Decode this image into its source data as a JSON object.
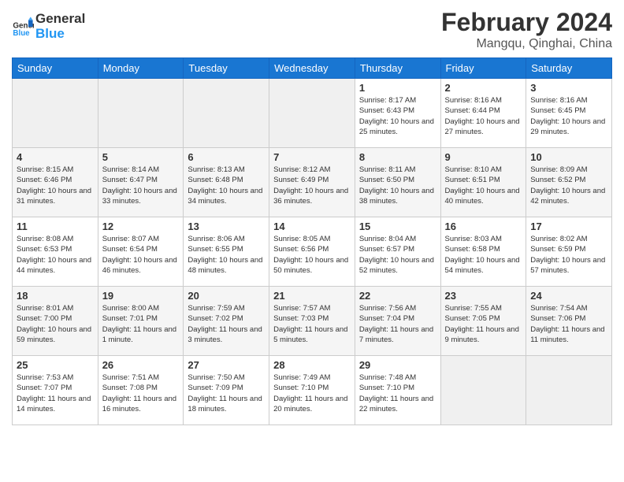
{
  "header": {
    "logo_line1": "General",
    "logo_line2": "Blue",
    "month_year": "February 2024",
    "location": "Mangqu, Qinghai, China"
  },
  "weekdays": [
    "Sunday",
    "Monday",
    "Tuesday",
    "Wednesday",
    "Thursday",
    "Friday",
    "Saturday"
  ],
  "weeks": [
    [
      {
        "day": "",
        "empty": true
      },
      {
        "day": "",
        "empty": true
      },
      {
        "day": "",
        "empty": true
      },
      {
        "day": "",
        "empty": true
      },
      {
        "day": "1",
        "sunrise": "8:17 AM",
        "sunset": "6:43 PM",
        "daylight": "10 hours and 25 minutes."
      },
      {
        "day": "2",
        "sunrise": "8:16 AM",
        "sunset": "6:44 PM",
        "daylight": "10 hours and 27 minutes."
      },
      {
        "day": "3",
        "sunrise": "8:16 AM",
        "sunset": "6:45 PM",
        "daylight": "10 hours and 29 minutes."
      }
    ],
    [
      {
        "day": "4",
        "sunrise": "8:15 AM",
        "sunset": "6:46 PM",
        "daylight": "10 hours and 31 minutes."
      },
      {
        "day": "5",
        "sunrise": "8:14 AM",
        "sunset": "6:47 PM",
        "daylight": "10 hours and 33 minutes."
      },
      {
        "day": "6",
        "sunrise": "8:13 AM",
        "sunset": "6:48 PM",
        "daylight": "10 hours and 34 minutes."
      },
      {
        "day": "7",
        "sunrise": "8:12 AM",
        "sunset": "6:49 PM",
        "daylight": "10 hours and 36 minutes."
      },
      {
        "day": "8",
        "sunrise": "8:11 AM",
        "sunset": "6:50 PM",
        "daylight": "10 hours and 38 minutes."
      },
      {
        "day": "9",
        "sunrise": "8:10 AM",
        "sunset": "6:51 PM",
        "daylight": "10 hours and 40 minutes."
      },
      {
        "day": "10",
        "sunrise": "8:09 AM",
        "sunset": "6:52 PM",
        "daylight": "10 hours and 42 minutes."
      }
    ],
    [
      {
        "day": "11",
        "sunrise": "8:08 AM",
        "sunset": "6:53 PM",
        "daylight": "10 hours and 44 minutes."
      },
      {
        "day": "12",
        "sunrise": "8:07 AM",
        "sunset": "6:54 PM",
        "daylight": "10 hours and 46 minutes."
      },
      {
        "day": "13",
        "sunrise": "8:06 AM",
        "sunset": "6:55 PM",
        "daylight": "10 hours and 48 minutes."
      },
      {
        "day": "14",
        "sunrise": "8:05 AM",
        "sunset": "6:56 PM",
        "daylight": "10 hours and 50 minutes."
      },
      {
        "day": "15",
        "sunrise": "8:04 AM",
        "sunset": "6:57 PM",
        "daylight": "10 hours and 52 minutes."
      },
      {
        "day": "16",
        "sunrise": "8:03 AM",
        "sunset": "6:58 PM",
        "daylight": "10 hours and 54 minutes."
      },
      {
        "day": "17",
        "sunrise": "8:02 AM",
        "sunset": "6:59 PM",
        "daylight": "10 hours and 57 minutes."
      }
    ],
    [
      {
        "day": "18",
        "sunrise": "8:01 AM",
        "sunset": "7:00 PM",
        "daylight": "10 hours and 59 minutes."
      },
      {
        "day": "19",
        "sunrise": "8:00 AM",
        "sunset": "7:01 PM",
        "daylight": "11 hours and 1 minute."
      },
      {
        "day": "20",
        "sunrise": "7:59 AM",
        "sunset": "7:02 PM",
        "daylight": "11 hours and 3 minutes."
      },
      {
        "day": "21",
        "sunrise": "7:57 AM",
        "sunset": "7:03 PM",
        "daylight": "11 hours and 5 minutes."
      },
      {
        "day": "22",
        "sunrise": "7:56 AM",
        "sunset": "7:04 PM",
        "daylight": "11 hours and 7 minutes."
      },
      {
        "day": "23",
        "sunrise": "7:55 AM",
        "sunset": "7:05 PM",
        "daylight": "11 hours and 9 minutes."
      },
      {
        "day": "24",
        "sunrise": "7:54 AM",
        "sunset": "7:06 PM",
        "daylight": "11 hours and 11 minutes."
      }
    ],
    [
      {
        "day": "25",
        "sunrise": "7:53 AM",
        "sunset": "7:07 PM",
        "daylight": "11 hours and 14 minutes."
      },
      {
        "day": "26",
        "sunrise": "7:51 AM",
        "sunset": "7:08 PM",
        "daylight": "11 hours and 16 minutes."
      },
      {
        "day": "27",
        "sunrise": "7:50 AM",
        "sunset": "7:09 PM",
        "daylight": "11 hours and 18 minutes."
      },
      {
        "day": "28",
        "sunrise": "7:49 AM",
        "sunset": "7:10 PM",
        "daylight": "11 hours and 20 minutes."
      },
      {
        "day": "29",
        "sunrise": "7:48 AM",
        "sunset": "7:10 PM",
        "daylight": "11 hours and 22 minutes."
      },
      {
        "day": "",
        "empty": true
      },
      {
        "day": "",
        "empty": true
      }
    ]
  ]
}
